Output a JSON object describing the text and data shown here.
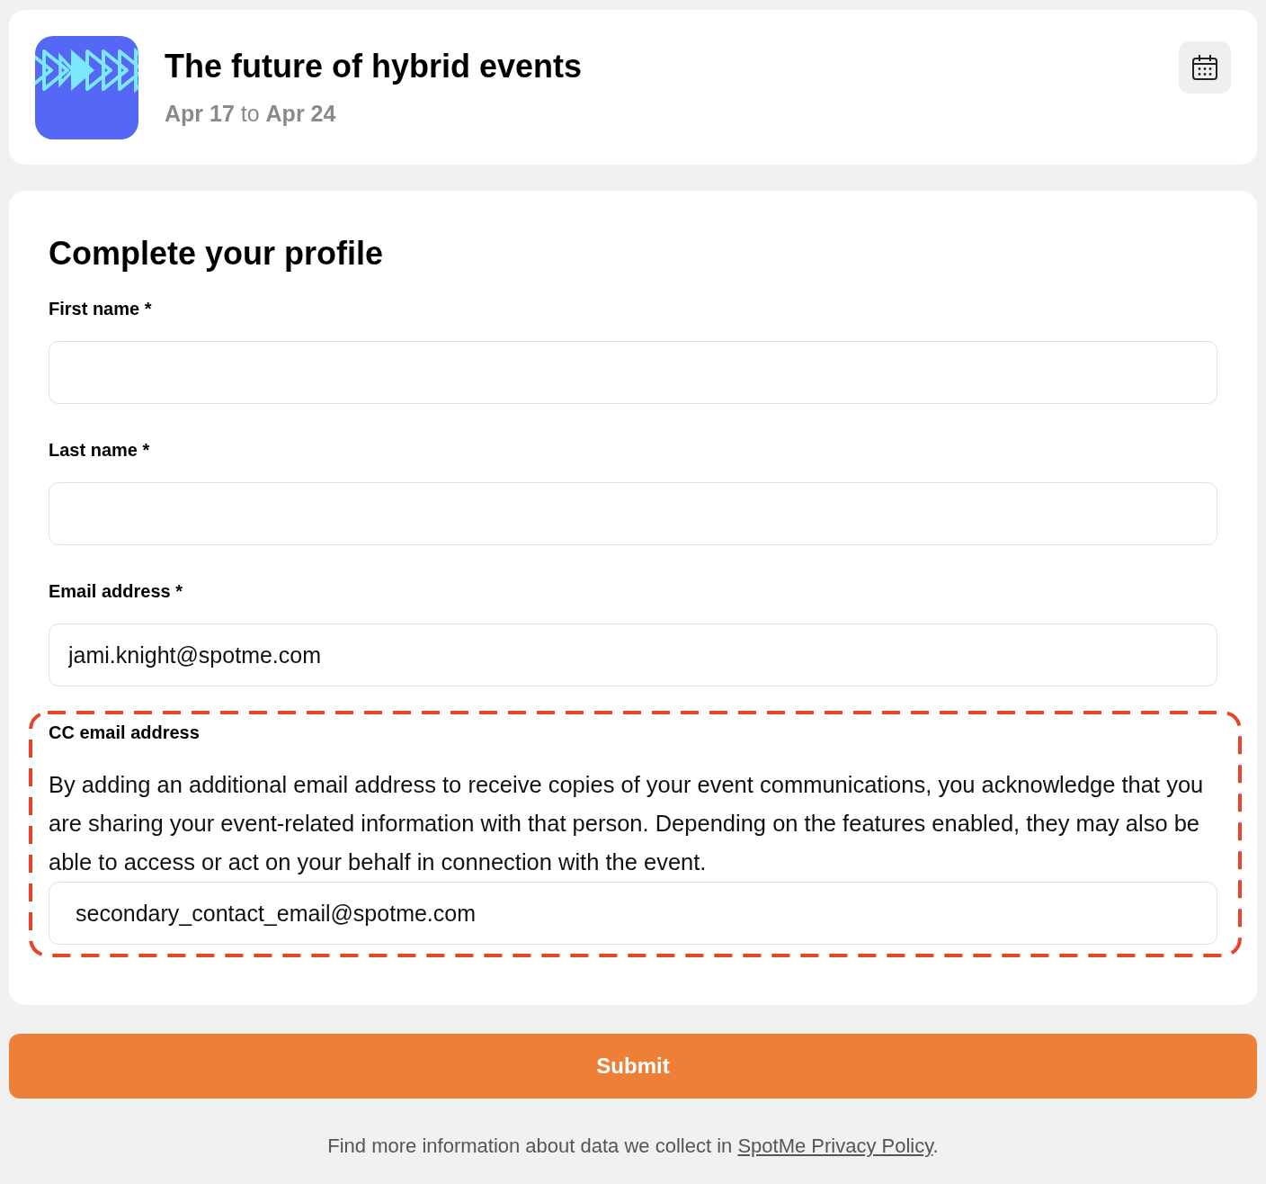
{
  "event": {
    "title": "The future of hybrid events",
    "dates": "**Apr 17** to **Apr 24**"
  },
  "form": {
    "heading": "Complete your profile",
    "fields": [
      {
        "label": "First name *",
        "highlighted": false
      },
      {
        "label": "Last name *",
        "highlighted": false
      },
      {
        "label": "Email address *",
        "value": "jami.knight@spotme.com",
        "highlighted": false
      },
      {
        "label": "CC email address",
        "description": "By adding an additional email address to receive copies of your event communications, you acknowledge that you are sharing your event-related information with that person. Depending on the features enabled, they may also be able to access or act on your behalf in connection with the event.",
        "value": "secondary_contact_email@spotme.com",
        "highlighted": true
      }
    ]
  },
  "submit": {
    "label": "Submit"
  },
  "footer": {
    "text": "Find more information about data we collect in ",
    "link": "SpotMe Privacy Policy",
    "end": "."
  }
}
